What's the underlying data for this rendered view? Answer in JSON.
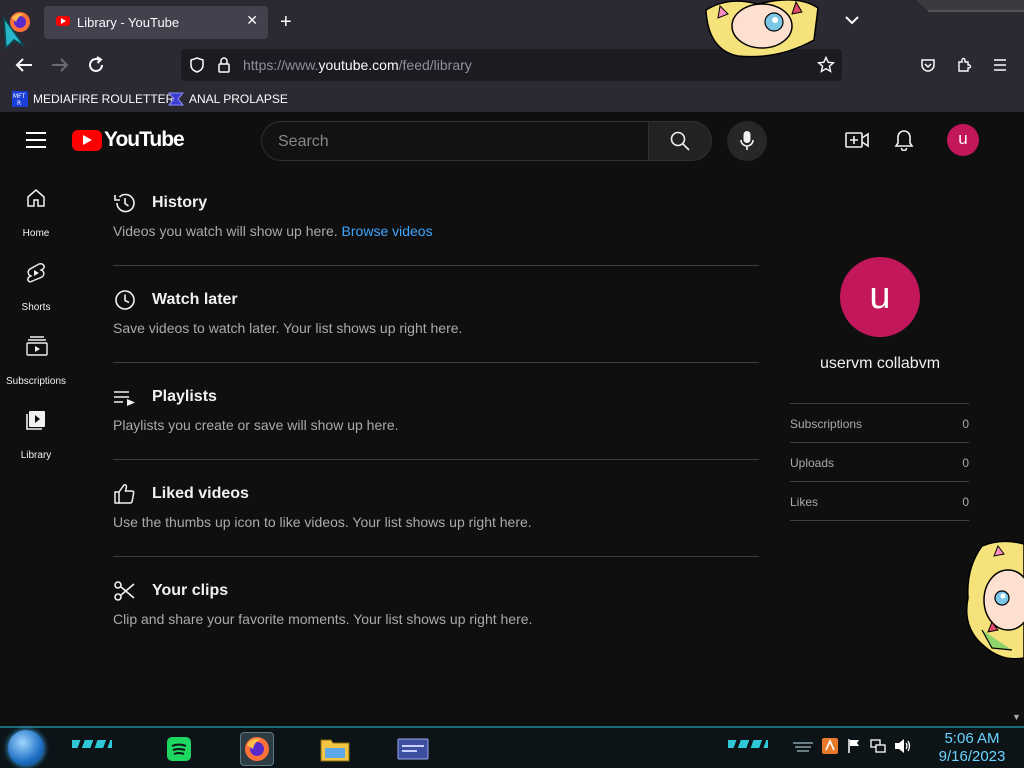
{
  "browser": {
    "tab_title": "Library - YouTube",
    "new_tab": "+",
    "url_prefix": "https://www.",
    "url_host": "youtube.com",
    "url_path": "/feed/library",
    "bookmarks": [
      {
        "label": "MEDIAFIRE ROULETTER",
        "icon": "mediafire-icon"
      },
      {
        "label": "ANAL PROLAPSE",
        "icon": "bookmark-icon"
      }
    ]
  },
  "masthead": {
    "logo_text": "YouTube",
    "search_placeholder": "Search",
    "avatar_letter": "u"
  },
  "guide": [
    {
      "label": "Home",
      "icon": "home-icon"
    },
    {
      "label": "Shorts",
      "icon": "shorts-icon"
    },
    {
      "label": "Subscriptions",
      "icon": "subscriptions-icon"
    },
    {
      "label": "Library",
      "icon": "library-icon"
    }
  ],
  "sections": [
    {
      "title": "History",
      "icon": "history-icon",
      "description": "Videos you watch will show up here.",
      "link": "Browse videos"
    },
    {
      "title": "Watch later",
      "icon": "clock-icon",
      "description": "Save videos to watch later. Your list shows up right here."
    },
    {
      "title": "Playlists",
      "icon": "playlist-icon",
      "description": "Playlists you create or save will show up here."
    },
    {
      "title": "Liked videos",
      "icon": "thumbs-up-icon",
      "description": "Use the thumbs up icon to like videos. Your list shows up right here."
    },
    {
      "title": "Your clips",
      "icon": "scissors-icon",
      "description": "Clip and share your favorite moments. Your list shows up right here."
    }
  ],
  "profile": {
    "avatar_letter": "u",
    "name": "uservm collabvm",
    "stats": [
      {
        "label": "Subscriptions",
        "value": "0"
      },
      {
        "label": "Uploads",
        "value": "0"
      },
      {
        "label": "Likes",
        "value": "0"
      }
    ]
  },
  "taskbar": {
    "time": "5:06 AM",
    "date": "9/16/2023",
    "apps": [
      "spotify-icon",
      "firefox-icon",
      "file-explorer-icon",
      "window-app-icon"
    ]
  },
  "colors": {
    "yt_red": "#ff0000",
    "avatar": "#c2185b",
    "link": "#3ea6ff",
    "background": "#0f0f0f"
  }
}
